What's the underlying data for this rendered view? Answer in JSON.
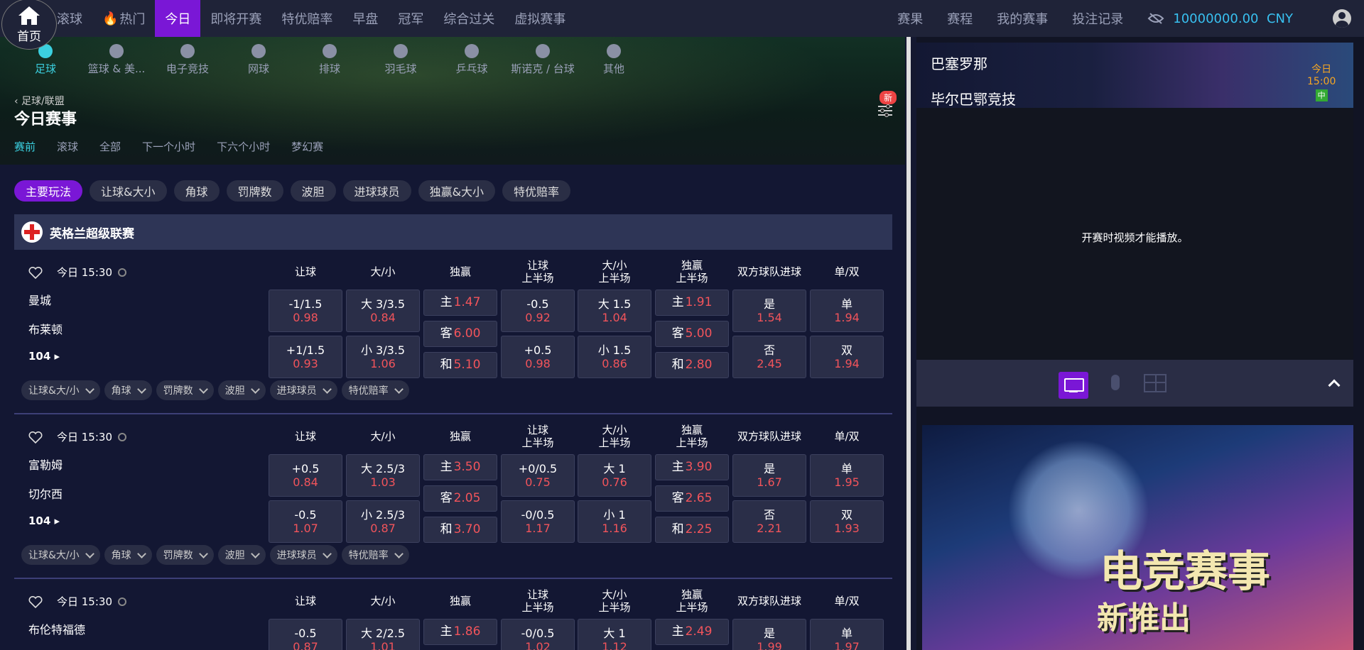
{
  "nav": {
    "home": "首页",
    "left": [
      "滚球",
      "热门",
      "今日",
      "即将开赛",
      "特优赔率",
      "早盘",
      "冠军",
      "综合过关",
      "虚拟赛事"
    ],
    "active": "今日",
    "right": [
      "赛果",
      "赛程",
      "我的赛事",
      "投注记录"
    ],
    "balance": "10000000.00",
    "currency": "CNY"
  },
  "sports": [
    "足球",
    "篮球 & 美...",
    "电子竞技",
    "网球",
    "排球",
    "羽毛球",
    "乒乓球",
    "斯诺克 / 台球",
    "其他"
  ],
  "breadcrumb": "足球/联盟",
  "page_title": "今日赛事",
  "new_badge": "新",
  "subtabs": [
    "赛前",
    "滚球",
    "全部",
    "下一个小时",
    "下六个小时",
    "梦幻赛"
  ],
  "market_pills": [
    "主要玩法",
    "让球&大小",
    "角球",
    "罚牌数",
    "波胆",
    "进球球员",
    "独赢&大小",
    "特优赔率"
  ],
  "league": "英格兰超级联赛",
  "columns": [
    "让球",
    "大/小",
    "独赢",
    "让球\n上半场",
    "大/小\n上半场",
    "独赢\n上半场",
    "双方球队进球",
    "单/双"
  ],
  "sub_markets": [
    "让球&大/小",
    "角球",
    "罚牌数",
    "波胆",
    "进球球员",
    "特优赔率"
  ],
  "matches": [
    {
      "time": "今日 15:30",
      "home": "曼城",
      "away": "布莱顿",
      "count": "104",
      "hcap": [
        [
          "-1/1.5",
          "0.98"
        ],
        [
          "+1/1.5",
          "0.93"
        ]
      ],
      "ou": [
        [
          "大 3/3.5",
          "0.84"
        ],
        [
          "小 3/3.5",
          "1.06"
        ]
      ],
      "x12": [
        [
          "主",
          "1.47"
        ],
        [
          "客",
          "6.00"
        ],
        [
          "和",
          "5.10"
        ]
      ],
      "hcap1": [
        [
          "-0.5",
          "0.92"
        ],
        [
          "+0.5",
          "0.98"
        ]
      ],
      "ou1": [
        [
          "大 1.5",
          "1.04"
        ],
        [
          "小 1.5",
          "0.86"
        ]
      ],
      "x121": [
        [
          "主",
          "1.91"
        ],
        [
          "客",
          "5.00"
        ],
        [
          "和",
          "2.80"
        ]
      ],
      "btts": [
        [
          "是",
          "1.54"
        ],
        [
          "否",
          "2.45"
        ]
      ],
      "oe": [
        [
          "单",
          "1.94"
        ],
        [
          "双",
          "1.94"
        ]
      ]
    },
    {
      "time": "今日 15:30",
      "home": "富勒姆",
      "away": "切尔西",
      "count": "104",
      "hcap": [
        [
          "+0.5",
          "0.84"
        ],
        [
          "-0.5",
          "1.07"
        ]
      ],
      "ou": [
        [
          "大 2.5/3",
          "1.03"
        ],
        [
          "小 2.5/3",
          "0.87"
        ]
      ],
      "x12": [
        [
          "主",
          "3.50"
        ],
        [
          "客",
          "2.05"
        ],
        [
          "和",
          "3.70"
        ]
      ],
      "hcap1": [
        [
          "+0/0.5",
          "0.75"
        ],
        [
          "-0/0.5",
          "1.17"
        ]
      ],
      "ou1": [
        [
          "大 1",
          "0.76"
        ],
        [
          "小 1",
          "1.16"
        ]
      ],
      "x121": [
        [
          "主",
          "3.90"
        ],
        [
          "客",
          "2.65"
        ],
        [
          "和",
          "2.25"
        ]
      ],
      "btts": [
        [
          "是",
          "1.67"
        ],
        [
          "否",
          "2.21"
        ]
      ],
      "oe": [
        [
          "单",
          "1.95"
        ],
        [
          "双",
          "1.93"
        ]
      ]
    },
    {
      "time": "今日 15:30",
      "home": "布伦特福德",
      "away": "",
      "count": "",
      "hcap": [
        [
          "-0.5",
          "0.87"
        ]
      ],
      "ou": [
        [
          "大 2/2.5",
          "1.01"
        ]
      ],
      "x12": [
        [
          "主",
          "1.86"
        ]
      ],
      "hcap1": [
        [
          "-0/0.5",
          "1.02"
        ]
      ],
      "ou1": [
        [
          "大 1",
          "1.12"
        ]
      ],
      "x121": [
        [
          "主",
          "2.49"
        ]
      ],
      "btts": [
        [
          "是",
          "1.99"
        ]
      ],
      "oe": [
        [
          "单",
          "1.97"
        ]
      ]
    }
  ],
  "video": {
    "team1": "巴塞罗那",
    "team2": "毕尔巴鄂竞技",
    "day": "今日",
    "time": "15:00",
    "lang": "中",
    "message": "开赛时视频才能播放。"
  },
  "banner": {
    "line1": "电竞赛事",
    "line2": "新推出"
  },
  "colors": {
    "accent": "#7a17d6",
    "odds": "#f2545b",
    "active_tab": "#3bd0e0",
    "balance": "#38c0f0"
  }
}
